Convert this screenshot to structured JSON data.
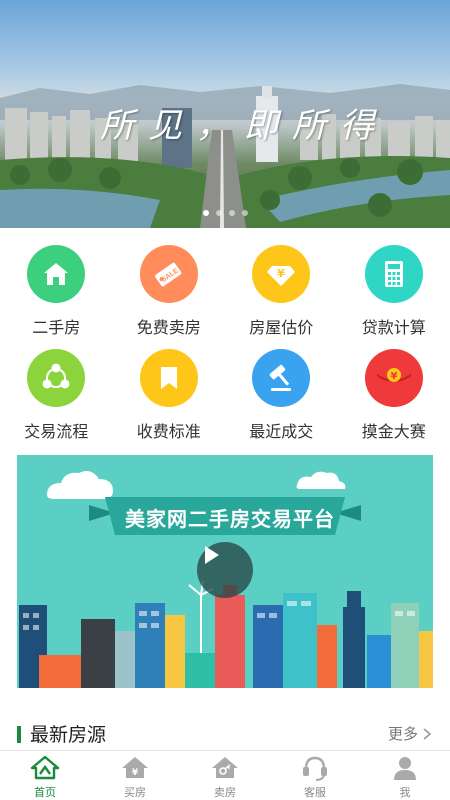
{
  "banner": {
    "caption": "所见，即所得",
    "dots": 4,
    "active_dot": 0
  },
  "grid": [
    {
      "id": "second-hand",
      "label": "二手房",
      "icon": "house-icon",
      "color": "#3ccf7e"
    },
    {
      "id": "free-sell",
      "label": "免费卖房",
      "icon": "sale-tag-icon",
      "color": "#ff8c5a"
    },
    {
      "id": "valuation",
      "label": "房屋估价",
      "icon": "diamond-yen-icon",
      "color": "#ffc61a"
    },
    {
      "id": "loan-calc",
      "label": "贷款计算",
      "icon": "calculator-icon",
      "color": "#2fd6c5"
    },
    {
      "id": "process",
      "label": "交易流程",
      "icon": "process-icon",
      "color": "#8cd43c"
    },
    {
      "id": "fees",
      "label": "收费标准",
      "icon": "bookmark-icon",
      "color": "#ffc61a"
    },
    {
      "id": "recent-deals",
      "label": "最近成交",
      "icon": "gavel-icon",
      "color": "#3aa3f0"
    },
    {
      "id": "contest",
      "label": "摸金大赛",
      "icon": "red-envelope-icon",
      "color": "#f0393b"
    }
  ],
  "video": {
    "title": "美家网二手房交易平台",
    "play_icon": "play-icon"
  },
  "section": {
    "title": "最新房源",
    "more": "更多"
  },
  "tabs": [
    {
      "id": "home",
      "label": "首页",
      "icon": "home-icon",
      "active": true
    },
    {
      "id": "buy",
      "label": "买房",
      "icon": "buy-house-icon",
      "active": false
    },
    {
      "id": "sell",
      "label": "卖房",
      "icon": "sell-house-icon",
      "active": false
    },
    {
      "id": "service",
      "label": "客服",
      "icon": "headset-icon",
      "active": false
    },
    {
      "id": "me",
      "label": "我",
      "icon": "user-icon",
      "active": false
    }
  ],
  "colors": {
    "brand_green": "#1a8b3a",
    "inactive_tab": "#aaaaaa"
  }
}
